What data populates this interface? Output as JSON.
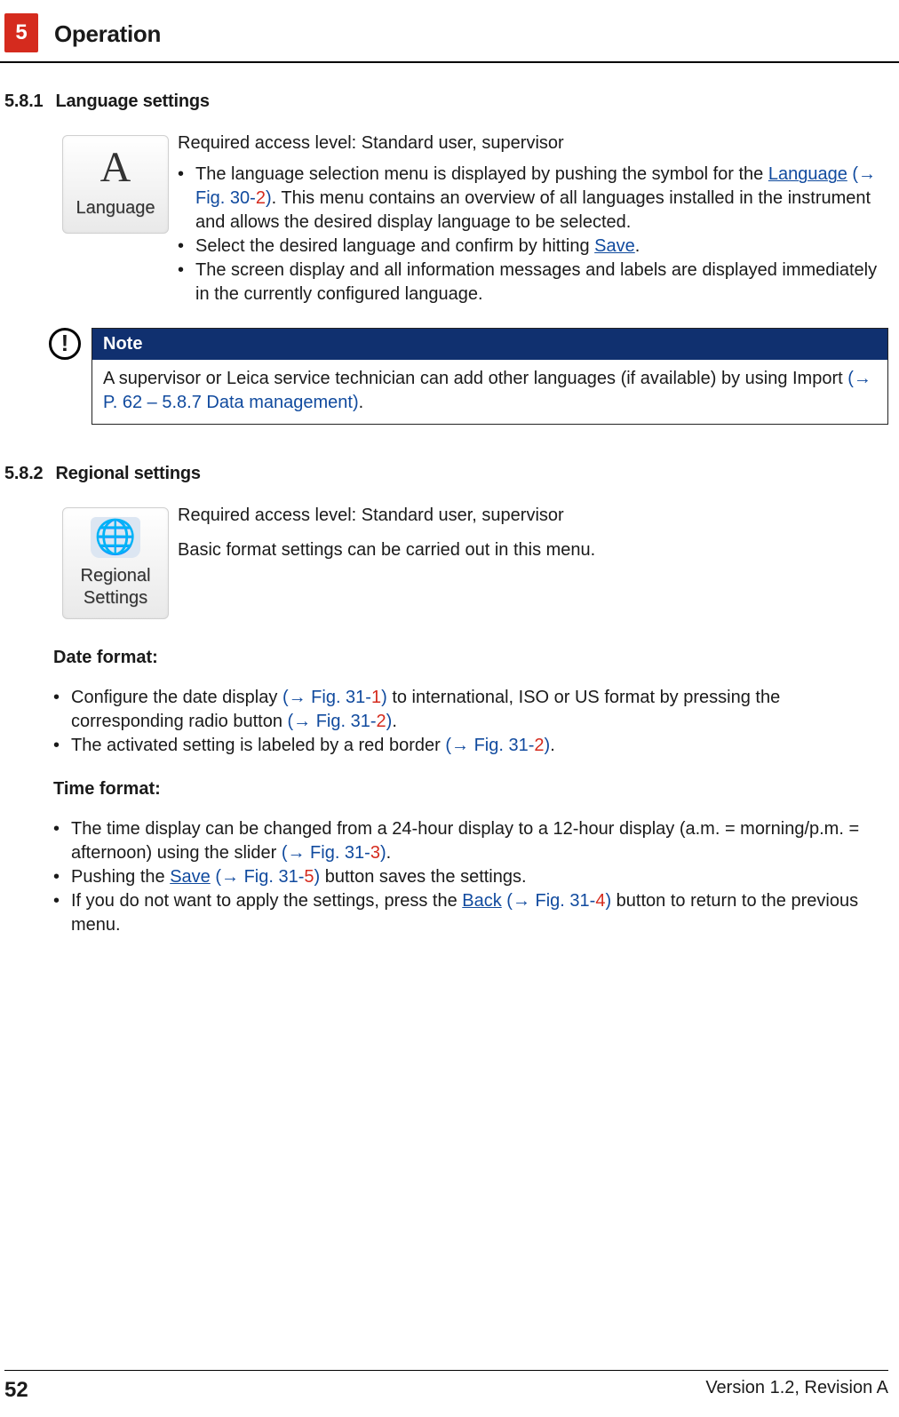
{
  "header": {
    "chapter_number": "5",
    "chapter_title": "Operation"
  },
  "sections": {
    "s581": {
      "number": "5.8.1",
      "title": "Language settings",
      "icon_caption": "Language",
      "access_level": "Required access level: Standard user, supervisor",
      "b1_a": "The language selection menu is displayed by pushing the symbol for the ",
      "b1_link": "Language",
      "b1_ref_open": "(→ Fig. 30",
      "b1_ref_dash": "-",
      "b1_ref_num": "2",
      "b1_ref_close": ")",
      "b1_b": ". This menu contains an overview of all languages installed in the instrument and allows the desired display language to be selected.",
      "b2_a": "Select the desired language and confirm by hitting ",
      "b2_link": "Save",
      "b2_b": ".",
      "b3": "The screen display and all information messages and labels are displayed immediately in the currently configured language."
    },
    "note": {
      "label": "Note",
      "body_a": "A supervisor or Leica service technician can add other languages (if available) by using Import ",
      "body_ref": "(→ P. 62 – 5.8.7 Data management)",
      "body_b": "."
    },
    "s582": {
      "number": "5.8.2",
      "title": "Regional settings",
      "icon_caption_1": "Regional",
      "icon_caption_2": "Settings",
      "access_level": "Required access level: Standard user, supervisor",
      "intro": "Basic format settings can be carried out in this menu."
    },
    "date_format": {
      "heading": "Date format:",
      "b1_a": "Configure the date display ",
      "b1_r1_open": "(→ Fig. 31",
      "b1_r1_dash": "-",
      "b1_r1_num": "1",
      "b1_r1_close": ")",
      "b1_b": " to international, ISO or US format by pressing the corresponding radio button ",
      "b1_r2_open": "(→ Fig. 31",
      "b1_r2_dash": "-",
      "b1_r2_num": "2",
      "b1_r2_close": ")",
      "b1_c": ".",
      "b2_a": "The activated setting is labeled by a red border ",
      "b2_r_open": "(→ Fig. 31",
      "b2_r_dash": "-",
      "b2_r_num": "2",
      "b2_r_close": ")",
      "b2_b": "."
    },
    "time_format": {
      "heading": "Time format:",
      "b1_a": "The time display can be changed from a 24-hour display to a 12-hour display (a.m. = morning/p.m. = afternoon) using the slider ",
      "b1_r_open": "(→ Fig. 31",
      "b1_r_dash": "-",
      "b1_r_num": "3",
      "b1_r_close": ")",
      "b1_b": ".",
      "b2_a": "Pushing the ",
      "b2_link": "Save",
      "b2_sp": " ",
      "b2_r_open": "(→ Fig. 31",
      "b2_r_dash": "-",
      "b2_r_num": "5",
      "b2_r_close": ")",
      "b2_b": " button saves the settings.",
      "b3_a": "If you do not want to apply the settings, press the ",
      "b3_link": "Back",
      "b3_sp": " ",
      "b3_r_open": "(→ Fig. 31",
      "b3_r_dash": "-",
      "b3_r_num": "4",
      "b3_r_close": ")",
      "b3_b": " button to return to the previous menu."
    }
  },
  "footer": {
    "page": "52",
    "version": "Version 1.2, Revision A"
  }
}
